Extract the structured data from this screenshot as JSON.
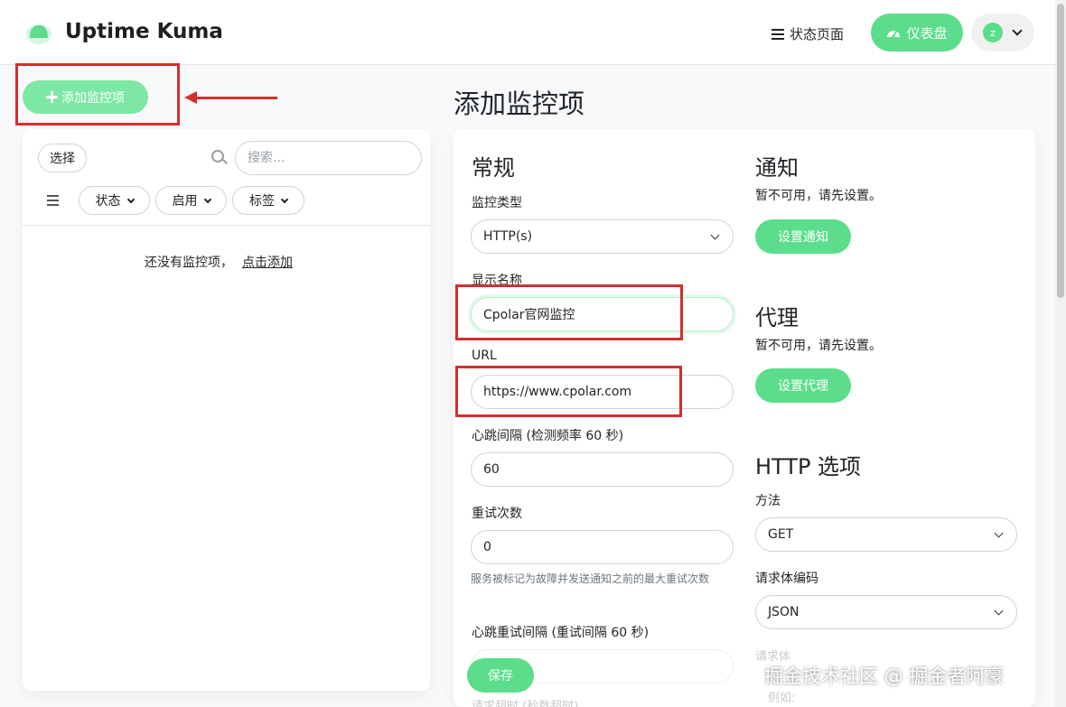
{
  "header": {
    "brand": "Uptime Kuma",
    "status_page": "状态页面",
    "dashboard": "仪表盘",
    "avatar_letter": "z"
  },
  "sidebar": {
    "add_monitor": "添加监控项",
    "select": "选择",
    "search_placeholder": "搜索...",
    "filters": [
      "状态",
      "启用",
      "标签"
    ],
    "empty_text": "还没有监控项，",
    "empty_link": "点击添加"
  },
  "main": {
    "title": "添加监控项",
    "general": {
      "heading": "常规",
      "monitor_type_label": "监控类型",
      "monitor_type_value": "HTTP(s)",
      "display_name_label": "显示名称",
      "display_name_value": "Cpolar官网监控",
      "url_label": "URL",
      "url_value": "https://www.cpolar.com",
      "heartbeat_label": "心跳间隔 (检测频率 60 秒)",
      "heartbeat_value": "60",
      "retries_label": "重试次数",
      "retries_value": "0",
      "retries_hint": "服务被标记为故障并发送通知之前的最大重试次数",
      "retry_interval_label": "心跳重试间隔 (重试间隔 60 秒)",
      "save": "保存",
      "faded_bottom": "请求超时 (秒数超时)"
    },
    "notifications": {
      "heading": "通知",
      "note": "暂不可用，请先设置。",
      "button": "设置通知"
    },
    "proxy": {
      "heading": "代理",
      "note": "暂不可用，请先设置。",
      "button": "设置代理"
    },
    "http_options": {
      "heading": "HTTP 选项",
      "method_label": "方法",
      "method_value": "GET",
      "body_encoding_label": "请求体编码",
      "body_encoding_value": "JSON",
      "body_label": "请求体",
      "body_placeholder": "例如:"
    }
  },
  "watermark": "掘金技术社区 @ 掘金者阿豪",
  "colors": {
    "accent": "#5cdd8b",
    "annotation": "#d32f2f"
  }
}
